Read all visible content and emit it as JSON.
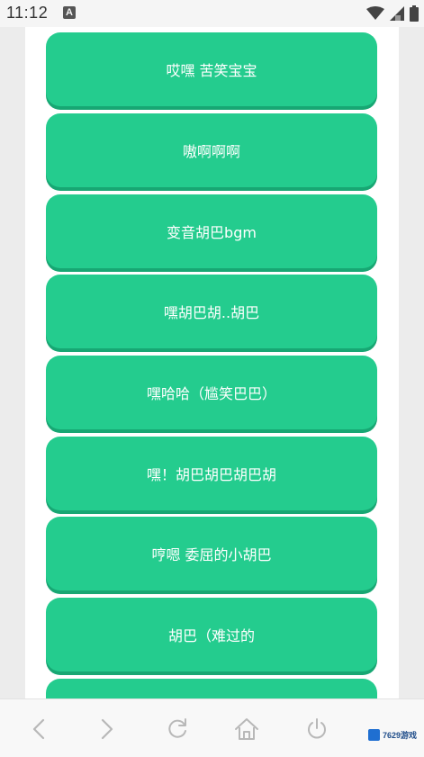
{
  "status_bar": {
    "time": "11:12",
    "notification_glyph": "A"
  },
  "buttons": [
    {
      "label": "哎嘿 苦笑宝宝"
    },
    {
      "label": "嗷啊啊啊"
    },
    {
      "label": "变音胡巴bgm"
    },
    {
      "label": "嘿胡巴胡..胡巴"
    },
    {
      "label": "嘿哈哈（尴笑巴巴）"
    },
    {
      "label": "嘿！胡巴胡巴胡巴胡"
    },
    {
      "label": "哼嗯 委屈的小胡巴"
    },
    {
      "label": "胡巴（难过的"
    },
    {
      "label": ""
    }
  ],
  "colors": {
    "button": "#24cc8e",
    "button_shadow": "#17a773",
    "content_bg": "#ffffff",
    "page_bg": "#ececec"
  },
  "nav_icons": [
    "back-icon",
    "forward-icon",
    "refresh-icon",
    "home-icon",
    "power-icon"
  ],
  "watermark": {
    "text": "7629游戏"
  }
}
